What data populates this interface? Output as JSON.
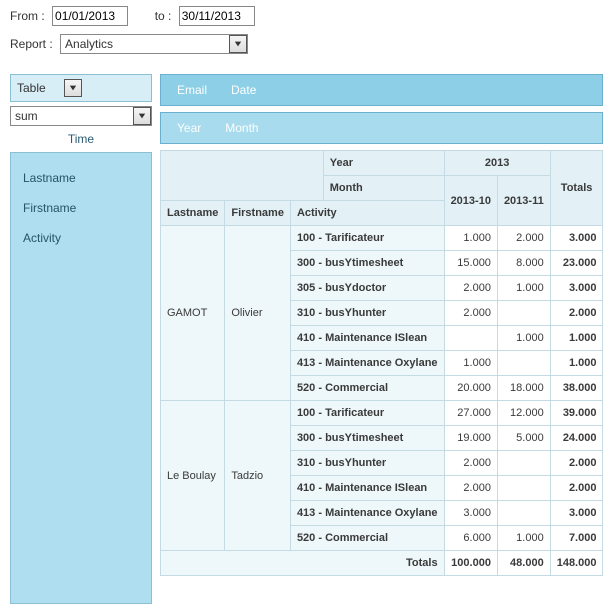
{
  "filters": {
    "from_label": "From :",
    "from_value": "01/01/2013",
    "to_label": "to :",
    "to_value": "30/11/2013",
    "report_label": "Report :",
    "report_value": "Analytics"
  },
  "builder": {
    "table_label": "Table",
    "agg_value": "sum",
    "time_label": "Time",
    "fields": [
      "Lastname",
      "Firstname",
      "Activity"
    ],
    "col_zone": [
      "Email",
      "Date"
    ],
    "row_zone": [
      "Year",
      "Month"
    ]
  },
  "pivot": {
    "col_group_label": "Year",
    "col_group_value": "2013",
    "sub_label": "Month",
    "sub_cols": [
      "2013-10",
      "2013-11"
    ],
    "totals_label": "Totals",
    "row_headers": [
      "Lastname",
      "Firstname",
      "Activity"
    ],
    "groups": [
      {
        "lastname": "GAMOT",
        "firstname": "Olivier",
        "rows": [
          {
            "activity": "100 - Tarificateur",
            "v": [
              "1.000",
              "2.000"
            ],
            "t": "3.000"
          },
          {
            "activity": "300 - busYtimesheet",
            "v": [
              "15.000",
              "8.000"
            ],
            "t": "23.000"
          },
          {
            "activity": "305 - busYdoctor",
            "v": [
              "2.000",
              "1.000"
            ],
            "t": "3.000"
          },
          {
            "activity": "310 - busYhunter",
            "v": [
              "2.000",
              ""
            ],
            "t": "2.000"
          },
          {
            "activity": "410 - Maintenance ISlean",
            "v": [
              "",
              "1.000"
            ],
            "t": "1.000"
          },
          {
            "activity": "413 - Maintenance Oxylane",
            "v": [
              "1.000",
              ""
            ],
            "t": "1.000"
          },
          {
            "activity": "520 - Commercial",
            "v": [
              "20.000",
              "18.000"
            ],
            "t": "38.000"
          }
        ]
      },
      {
        "lastname": "Le Boulay",
        "firstname": "Tadzio",
        "rows": [
          {
            "activity": "100 - Tarificateur",
            "v": [
              "27.000",
              "12.000"
            ],
            "t": "39.000"
          },
          {
            "activity": "300 - busYtimesheet",
            "v": [
              "19.000",
              "5.000"
            ],
            "t": "24.000"
          },
          {
            "activity": "310 - busYhunter",
            "v": [
              "2.000",
              ""
            ],
            "t": "2.000"
          },
          {
            "activity": "410 - Maintenance ISlean",
            "v": [
              "2.000",
              ""
            ],
            "t": "2.000"
          },
          {
            "activity": "413 - Maintenance Oxylane",
            "v": [
              "3.000",
              ""
            ],
            "t": "3.000"
          },
          {
            "activity": "520 - Commercial",
            "v": [
              "6.000",
              "1.000"
            ],
            "t": "7.000"
          }
        ]
      }
    ],
    "grand_totals": {
      "v": [
        "100.000",
        "48.000"
      ],
      "t": "148.000"
    }
  }
}
